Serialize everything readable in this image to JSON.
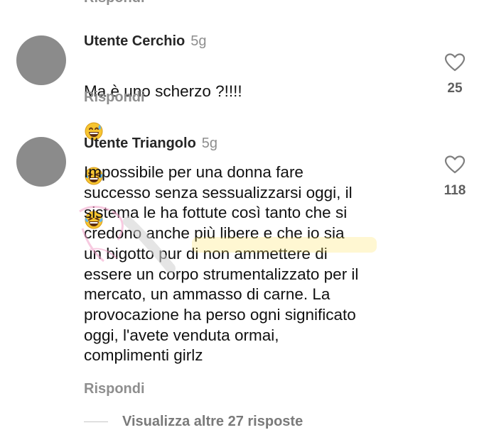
{
  "top_cut_text": "Rispondi",
  "comments": [
    {
      "username": "Utente Cerchio",
      "age": "5g",
      "text": "Ma è uno scherzo ?!!!!",
      "emojis": [
        "grin-sweat-emoji",
        "laugh-cry-emoji",
        "laugh-cry-emoji"
      ],
      "reply_label": "Rispondi",
      "likes": "25"
    },
    {
      "username": "Utente Triangolo",
      "age": "5g",
      "text": "Impossibile per una donna fare\nsuccesso senza sessualizzarsi oggi, il\nsistema le ha fottute così tanto che si\ncredono anche più libere e che io sia\nun bigotto pur di non ammettere di\nessere un corpo strumentalizzato per il\nmercato, un ammasso di carne. La\nprovocazione ha perso ogni significato\noggi, l'avete venduta ormai,\ncomplimenti girlz",
      "reply_label": "Rispondi",
      "likes": "118"
    }
  ],
  "more_replies_label": "Visualizza altre 27 risposte",
  "colors": {
    "avatar": "#8b8b8b",
    "muted": "#8e8e8e",
    "text": "#111111"
  }
}
